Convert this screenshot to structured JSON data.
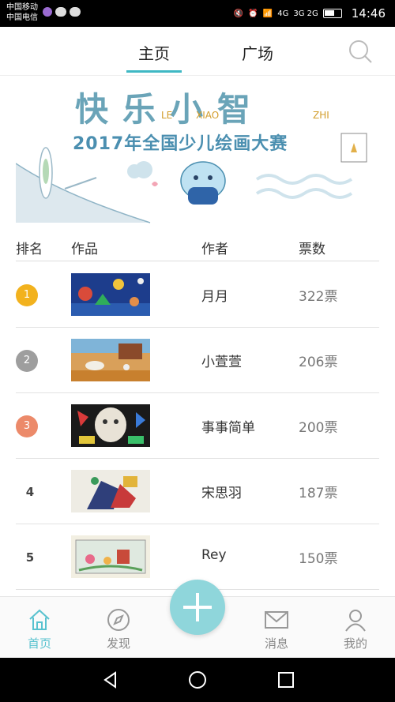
{
  "status_bar": {
    "carrier1": "中国移动",
    "carrier2": "中国电信",
    "network": "4G",
    "network2": "3G 2G",
    "time": "14:46"
  },
  "header": {
    "tabs": [
      {
        "label": "主页",
        "active": true
      },
      {
        "label": "广场",
        "active": false
      }
    ],
    "search_icon": "search-icon",
    "accent_color": "#3fb8c4"
  },
  "banner": {
    "title": "快乐小智",
    "pinyin": [
      "LE",
      "XIAO",
      "ZHI"
    ],
    "subtitle": "2017年全国少儿绘画大赛"
  },
  "table": {
    "headers": [
      "排名",
      "作品",
      "作者",
      "票数"
    ],
    "rows": [
      {
        "rank": "1",
        "author": "月月",
        "votes": "322票",
        "badge_color": "#f2b21e"
      },
      {
        "rank": "2",
        "author": "小萱萱",
        "votes": "206票",
        "badge_color": "#9e9e9e"
      },
      {
        "rank": "3",
        "author": "事事简单",
        "votes": "200票",
        "badge_color": "#ec8a6a"
      },
      {
        "rank": "4",
        "author": "宋思羽",
        "votes": "187票",
        "badge_color": ""
      },
      {
        "rank": "5",
        "author": "Rey",
        "votes": "150票",
        "badge_color": ""
      }
    ]
  },
  "bottom_nav": {
    "items": [
      {
        "label": "首页",
        "icon": "home-icon",
        "active": true
      },
      {
        "label": "发现",
        "icon": "compass-icon",
        "active": false
      },
      {
        "label": "消息",
        "icon": "mail-icon",
        "active": false
      },
      {
        "label": "我的",
        "icon": "person-icon",
        "active": false
      }
    ],
    "fab_icon": "plus-icon"
  }
}
